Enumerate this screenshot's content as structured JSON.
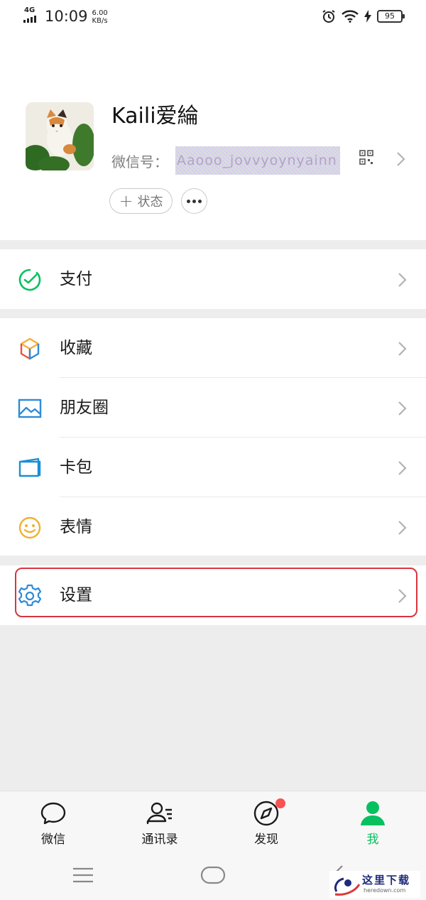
{
  "status_bar": {
    "network": "4G",
    "time": "10:09",
    "speed_value": "6.00",
    "speed_unit": "KB/s",
    "battery": "95"
  },
  "profile": {
    "nickname": "Kaili爱綸",
    "wechat_id_label": "微信号：",
    "wechat_id_value_obscured": "Aaooo_jovvyoynyainn",
    "status_button_label": "状态",
    "status_button_icon": "plus-icon",
    "more_button_icon": "more-icon"
  },
  "menu": {
    "pay": {
      "label": "支付",
      "icon": "pay-icon",
      "color": "#07c160"
    },
    "favorites": {
      "label": "收藏",
      "icon": "favorites-cube-icon"
    },
    "moments": {
      "label": "朋友圈",
      "icon": "moments-photo-icon",
      "color": "#2e8bd6"
    },
    "cards": {
      "label": "卡包",
      "icon": "card-wallet-icon",
      "color": "#1a8ed6"
    },
    "stickers": {
      "label": "表情",
      "icon": "smiley-icon",
      "color": "#f2b033"
    },
    "settings": {
      "label": "设置",
      "icon": "gear-icon",
      "color": "#2e8bd6",
      "highlighted": true
    }
  },
  "tabbar": {
    "tabs": [
      {
        "label": "微信",
        "icon": "chat-bubble-icon"
      },
      {
        "label": "通讯录",
        "icon": "contacts-icon"
      },
      {
        "label": "发现",
        "icon": "compass-icon",
        "has_badge": true
      },
      {
        "label": "我",
        "icon": "me-person-icon",
        "active": true
      }
    ],
    "active_color": "#07c160"
  },
  "system_nav": {
    "buttons": [
      "menu-icon",
      "home-icon",
      "back-icon"
    ]
  },
  "watermark": {
    "text": "这里下载",
    "url": "heredown.com"
  }
}
